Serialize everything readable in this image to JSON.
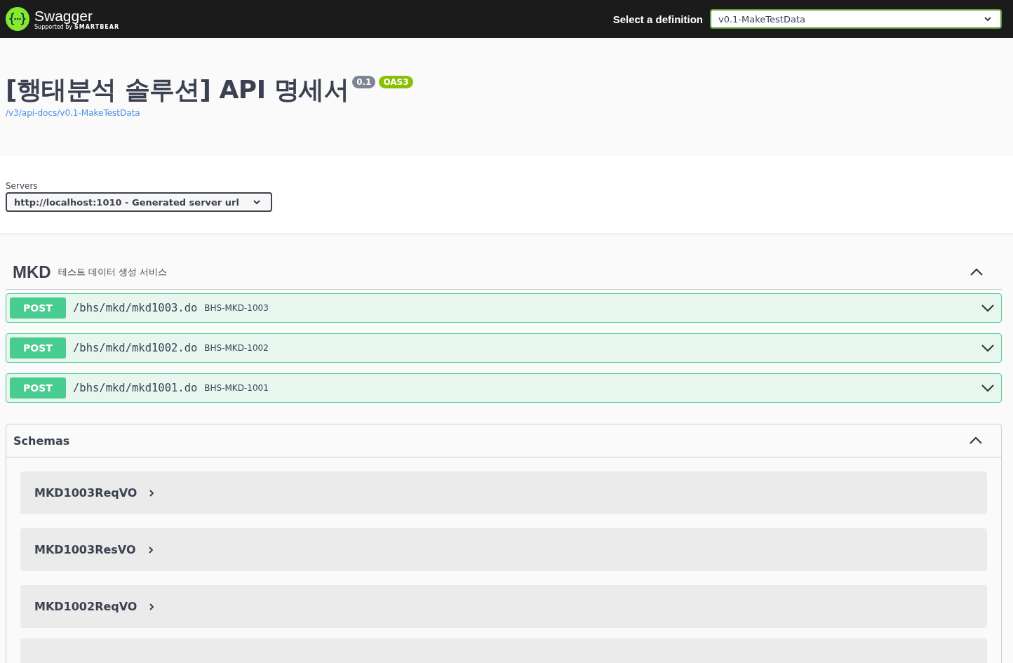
{
  "topbar": {
    "logo_name": "Swagger",
    "logo_tagline": "Supported by",
    "logo_brand": "SMARTBEAR",
    "definition_label": "Select a definition",
    "definition_value": "v0.1-MakeTestData"
  },
  "info": {
    "title": "[행태분석 솔루션] API 명세서",
    "version": "0.1",
    "oas": "OAS3",
    "spec_link": "/v3/api-docs/v0.1-MakeTestData"
  },
  "servers": {
    "label": "Servers",
    "value": "http://localhost:1010 - Generated server url"
  },
  "tag": {
    "name": "MKD",
    "description": "테스트 데이터 생성 서비스",
    "expanded": true
  },
  "operations": [
    {
      "method": "POST",
      "path": "/bhs/mkd/mkd1003.do",
      "summary": "BHS-MKD-1003",
      "expanded": false
    },
    {
      "method": "POST",
      "path": "/bhs/mkd/mkd1002.do",
      "summary": "BHS-MKD-1002",
      "expanded": false
    },
    {
      "method": "POST",
      "path": "/bhs/mkd/mkd1001.do",
      "summary": "BHS-MKD-1001",
      "expanded": false
    }
  ],
  "schemas": {
    "title": "Schemas",
    "expanded": true,
    "items": [
      {
        "name": "MKD1003ReqVO",
        "expanded": false
      },
      {
        "name": "MKD1003ResVO",
        "expanded": false
      },
      {
        "name": "MKD1002ReqVO",
        "expanded": false
      }
    ]
  }
}
